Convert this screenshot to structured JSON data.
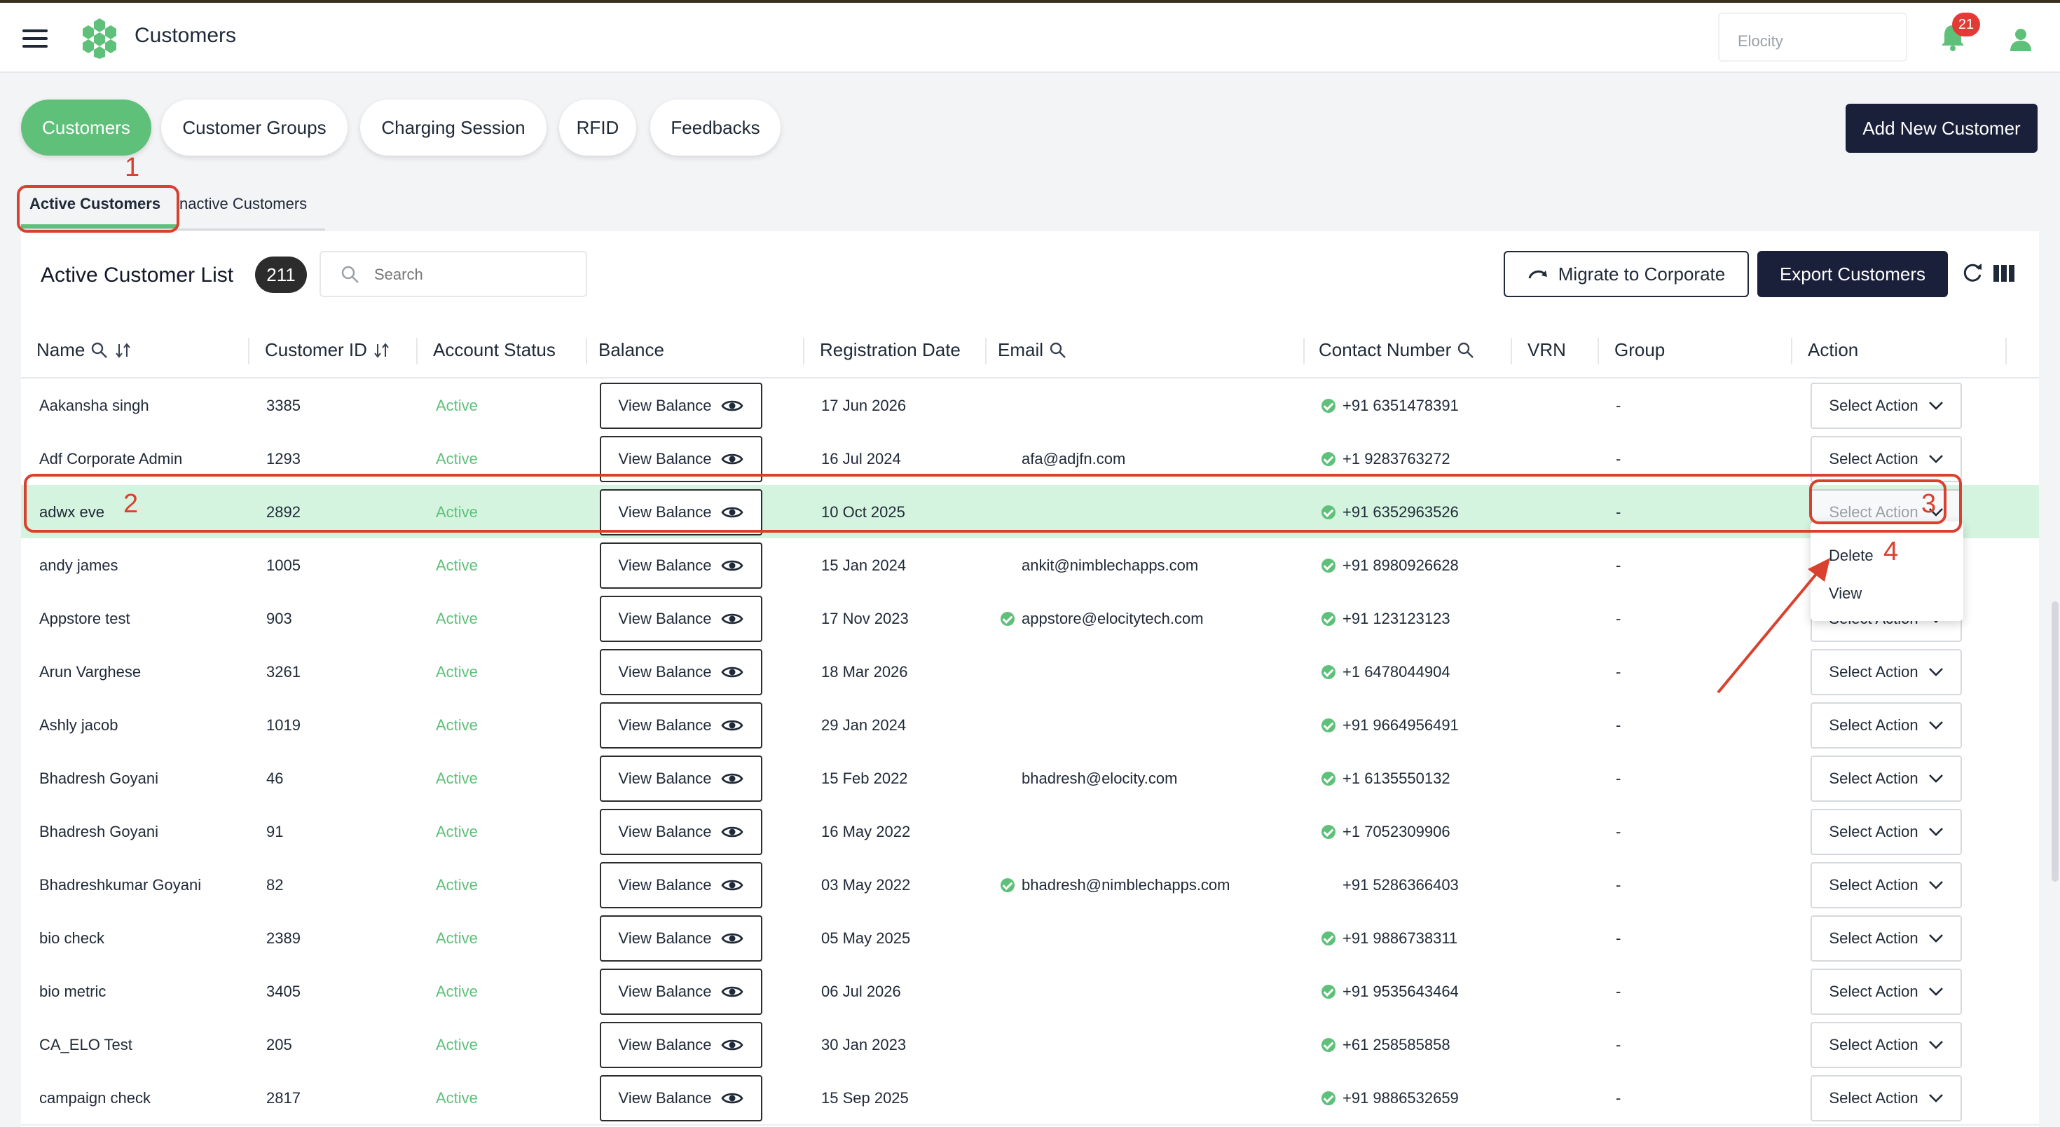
{
  "app": {
    "title": "Customers",
    "org_select_value": "Elocity",
    "notification_count": "21"
  },
  "nav_tabs": [
    {
      "label": "Customers",
      "active": true
    },
    {
      "label": "Customer Groups",
      "active": false
    },
    {
      "label": "Charging Session",
      "active": false
    },
    {
      "label": "RFID",
      "active": false
    },
    {
      "label": "Feedbacks",
      "active": false
    }
  ],
  "add_button": "Add New Customer",
  "sub_tabs": {
    "active": "Active Customers",
    "inactive": "nactive Customers"
  },
  "list": {
    "title": "Active Customer List",
    "count": "211",
    "search_placeholder": "Search",
    "migrate_label": "Migrate to Corporate",
    "export_label": "Export Customers"
  },
  "columns": [
    "Name",
    "Customer ID",
    "Account Status",
    "Balance",
    "Registration Date",
    "Email",
    "Contact Number",
    "VRN",
    "Group",
    "Action"
  ],
  "rows": [
    {
      "name": "Aakansha singh",
      "id": "3385",
      "status": "Active",
      "balance": "View Balance",
      "date": "17 Jun 2026",
      "email": "",
      "email_verified": false,
      "phone": "+91 6351478391",
      "phone_verified": true,
      "vrn": "",
      "group": "-",
      "action": "Select Action"
    },
    {
      "name": "Adf Corporate Admin",
      "id": "1293",
      "status": "Active",
      "balance": "View Balance",
      "date": "16 Jul 2024",
      "email": "afa@adjfn.com",
      "email_verified": false,
      "phone": "+1 9283763272",
      "phone_verified": true,
      "vrn": "",
      "group": "-",
      "action": "Select Action"
    },
    {
      "name": "adwx eve",
      "id": "2892",
      "status": "Active",
      "balance": "View Balance",
      "date": "10 Oct 2025",
      "email": "",
      "email_verified": false,
      "phone": "+91 6352963526",
      "phone_verified": true,
      "vrn": "",
      "group": "-",
      "action": "Select Action"
    },
    {
      "name": "andy james",
      "id": "1005",
      "status": "Active",
      "balance": "View Balance",
      "date": "15 Jan 2024",
      "email": "ankit@nimblechapps.com",
      "email_verified": false,
      "phone": "+91 8980926628",
      "phone_verified": true,
      "vrn": "",
      "group": "-",
      "action": "Select Action"
    },
    {
      "name": "Appstore test",
      "id": "903",
      "status": "Active",
      "balance": "View Balance",
      "date": "17 Nov 2023",
      "email": "appstore@elocitytech.com",
      "email_verified": true,
      "phone": "+91 123123123",
      "phone_verified": true,
      "vrn": "",
      "group": "-",
      "action": "Select Action"
    },
    {
      "name": "Arun Varghese",
      "id": "3261",
      "status": "Active",
      "balance": "View Balance",
      "date": "18 Mar 2026",
      "email": "",
      "email_verified": false,
      "phone": "+1 6478044904",
      "phone_verified": true,
      "vrn": "",
      "group": "-",
      "action": "Select Action"
    },
    {
      "name": "Ashly jacob",
      "id": "1019",
      "status": "Active",
      "balance": "View Balance",
      "date": "29 Jan 2024",
      "email": "",
      "email_verified": false,
      "phone": "+91 9664956491",
      "phone_verified": true,
      "vrn": "",
      "group": "-",
      "action": "Select Action"
    },
    {
      "name": "Bhadresh Goyani",
      "id": "46",
      "status": "Active",
      "balance": "View Balance",
      "date": "15 Feb 2022",
      "email": "bhadresh@elocity.com",
      "email_verified": false,
      "phone": "+1 6135550132",
      "phone_verified": true,
      "vrn": "",
      "group": "-",
      "action": "Select Action"
    },
    {
      "name": "Bhadresh Goyani",
      "id": "91",
      "status": "Active",
      "balance": "View Balance",
      "date": "16 May 2022",
      "email": "",
      "email_verified": false,
      "phone": "+1 7052309906",
      "phone_verified": true,
      "vrn": "",
      "group": "-",
      "action": "Select Action"
    },
    {
      "name": "Bhadreshkumar Goyani",
      "id": "82",
      "status": "Active",
      "balance": "View Balance",
      "date": "03 May 2022",
      "email": "bhadresh@nimblechapps.com",
      "email_verified": true,
      "phone": "+91 5286366403",
      "phone_verified": false,
      "vrn": "",
      "group": "-",
      "action": "Select Action"
    },
    {
      "name": "bio check",
      "id": "2389",
      "status": "Active",
      "balance": "View Balance",
      "date": "05 May 2025",
      "email": "",
      "email_verified": false,
      "phone": "+91 9886738311",
      "phone_verified": true,
      "vrn": "",
      "group": "-",
      "action": "Select Action"
    },
    {
      "name": "bio metric",
      "id": "3405",
      "status": "Active",
      "balance": "View Balance",
      "date": "06 Jul 2026",
      "email": "",
      "email_verified": false,
      "phone": "+91 9535643464",
      "phone_verified": true,
      "vrn": "",
      "group": "-",
      "action": "Select Action"
    },
    {
      "name": "CA_ELO Test",
      "id": "205",
      "status": "Active",
      "balance": "View Balance",
      "date": "30 Jan 2023",
      "email": "",
      "email_verified": false,
      "phone": "+61 258585858",
      "phone_verified": true,
      "vrn": "",
      "group": "-",
      "action": "Select Action"
    },
    {
      "name": "campaign check",
      "id": "2817",
      "status": "Active",
      "balance": "View Balance",
      "date": "15 Sep 2025",
      "email": "",
      "email_verified": false,
      "phone": "+91 9886532659",
      "phone_verified": true,
      "vrn": "",
      "group": "-",
      "action": "Select Action"
    }
  ],
  "highlight_row_index": 2,
  "open_dropdown": {
    "row_index": 2,
    "items": [
      "Delete",
      "View"
    ]
  },
  "annotations": [
    "1",
    "2",
    "3",
    "4"
  ],
  "colors": {
    "accent": "#5fc07a",
    "dark_button": "#1a1f3a",
    "annotation": "#d9412e",
    "badge": "#e53935",
    "highlight_row": "#d4f4df"
  },
  "icons": [
    "menu-icon",
    "app-logo",
    "bell-icon",
    "user-icon",
    "search-icon",
    "migrate-icon",
    "refresh-icon",
    "columns-icon",
    "eye-icon",
    "chevron-down-icon",
    "verified-check-icon",
    "sort-icon"
  ]
}
